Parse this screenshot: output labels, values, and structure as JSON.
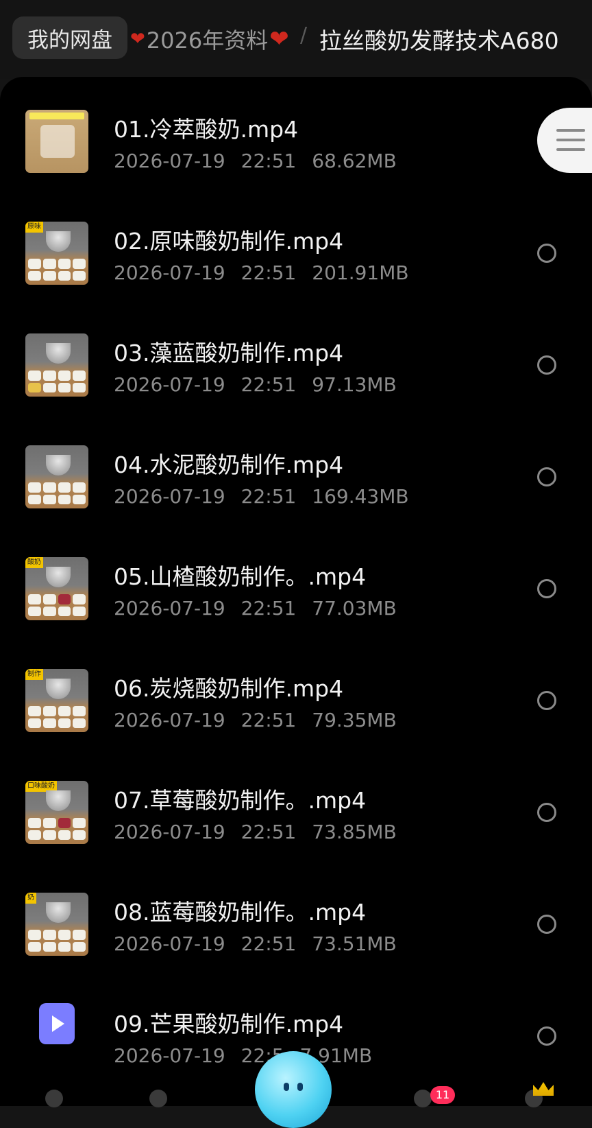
{
  "breadcrumb": {
    "root": "我的网盘",
    "folder": "2026年资料",
    "current": "拉丝酸奶发酵技术A680"
  },
  "files": [
    {
      "name": "01.冷萃酸奶.mp4",
      "date": "2026-07-19",
      "time": "22:51",
      "size": "68.62MB",
      "thumb_tag": ""
    },
    {
      "name": "02.原味酸奶制作.mp4",
      "date": "2026-07-19",
      "time": "22:51",
      "size": "201.91MB",
      "thumb_tag": "原味"
    },
    {
      "name": "03.藻蓝酸奶制作.mp4",
      "date": "2026-07-19",
      "time": "22:51",
      "size": "97.13MB",
      "thumb_tag": ""
    },
    {
      "name": "04.水泥酸奶制作.mp4",
      "date": "2026-07-19",
      "time": "22:51",
      "size": "169.43MB",
      "thumb_tag": ""
    },
    {
      "name": "05.山楂酸奶制作。.mp4",
      "date": "2026-07-19",
      "time": "22:51",
      "size": "77.03MB",
      "thumb_tag": "酸奶"
    },
    {
      "name": "06.炭烧酸奶制作.mp4",
      "date": "2026-07-19",
      "time": "22:51",
      "size": "79.35MB",
      "thumb_tag": "制作"
    },
    {
      "name": "07.草莓酸奶制作。.mp4",
      "date": "2026-07-19",
      "time": "22:51",
      "size": "73.85MB",
      "thumb_tag": "口味酸奶"
    },
    {
      "name": "08.蓝莓酸奶制作。.mp4",
      "date": "2026-07-19",
      "time": "22:51",
      "size": "73.51MB",
      "thumb_tag": "奶"
    },
    {
      "name": "09.芒果酸奶制作.mp4",
      "date": "2026-07-19",
      "time": "22:5",
      "size": "7.91MB",
      "thumb_tag": ""
    }
  ],
  "bottom": {
    "badge_count": "11"
  },
  "colors": {
    "background": "#000000",
    "accent_video_icon": "#7b7dff",
    "heart": "#d0281e",
    "badge": "#ff2d5a"
  },
  "icons": {
    "menu": "hamburger-menu-icon",
    "select": "radio-circle-icon",
    "video": "video-file-icon"
  }
}
